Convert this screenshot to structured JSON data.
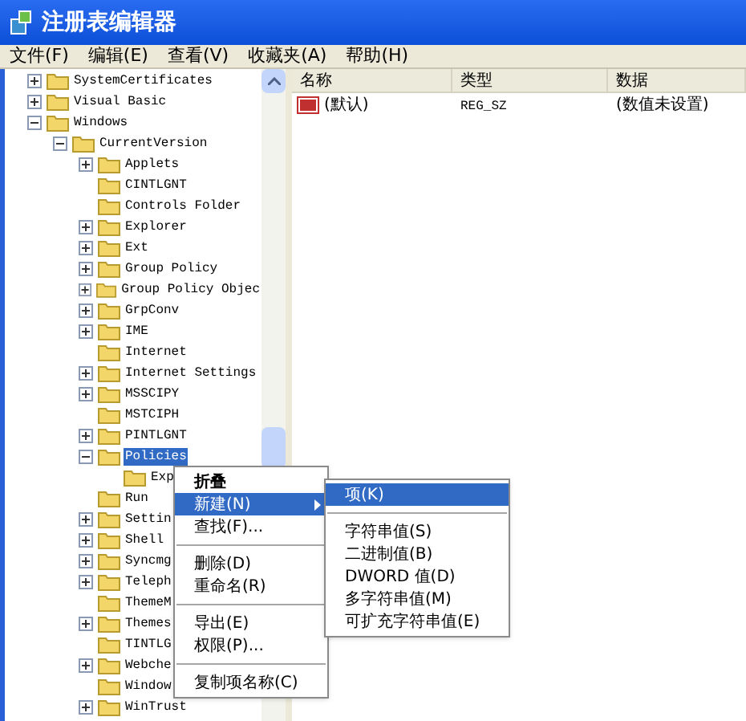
{
  "window": {
    "title": "注册表编辑器"
  },
  "menu_bar": [
    "文件(F)",
    "编辑(E)",
    "查看(V)",
    "收藏夹(A)",
    "帮助(H)"
  ],
  "tree": [
    {
      "label": "SystemCertificates",
      "kind": "node",
      "expanded": false,
      "selected": false
    },
    {
      "label": "Visual Basic",
      "kind": "node",
      "expanded": false,
      "selected": false
    },
    {
      "label": "Windows",
      "kind": "node",
      "expanded": true,
      "selected": false,
      "children": [
        {
          "label": "CurrentVersion",
          "kind": "node",
          "expanded": true,
          "selected": false,
          "children": [
            {
              "label": "Applets",
              "kind": "node",
              "expanded": false,
              "selected": false
            },
            {
              "label": "CINTLGNT",
              "kind": "leaf",
              "selected": false
            },
            {
              "label": "Controls Folder",
              "kind": "leaf",
              "selected": false
            },
            {
              "label": "Explorer",
              "kind": "node",
              "expanded": false,
              "selected": false
            },
            {
              "label": "Ext",
              "kind": "node",
              "expanded": false,
              "selected": false
            },
            {
              "label": "Group Policy",
              "kind": "node",
              "expanded": false,
              "selected": false
            },
            {
              "label": "Group Policy Objec",
              "kind": "node",
              "expanded": false,
              "selected": false
            },
            {
              "label": "GrpConv",
              "kind": "node",
              "expanded": false,
              "selected": false
            },
            {
              "label": "IME",
              "kind": "node",
              "expanded": false,
              "selected": false
            },
            {
              "label": "Internet",
              "kind": "leaf",
              "selected": false
            },
            {
              "label": "Internet Settings",
              "kind": "node",
              "expanded": false,
              "selected": false
            },
            {
              "label": "MSSCIPY",
              "kind": "node",
              "expanded": false,
              "selected": false
            },
            {
              "label": "MSTCIPH",
              "kind": "leaf",
              "selected": false
            },
            {
              "label": "PINTLGNT",
              "kind": "node",
              "expanded": false,
              "selected": false
            },
            {
              "label": "Policies",
              "kind": "node",
              "expanded": true,
              "selected": true,
              "children": [
                {
                  "label": "Exp",
                  "kind": "leaf",
                  "selected": false
                }
              ]
            },
            {
              "label": "Run",
              "kind": "leaf",
              "selected": false
            },
            {
              "label": "Settin",
              "kind": "node",
              "expanded": false,
              "selected": false
            },
            {
              "label": "Shell",
              "kind": "node",
              "expanded": false,
              "selected": false
            },
            {
              "label": "Syncmg",
              "kind": "node",
              "expanded": false,
              "selected": false
            },
            {
              "label": "Teleph",
              "kind": "node",
              "expanded": false,
              "selected": false
            },
            {
              "label": "ThemeM",
              "kind": "leaf",
              "selected": false
            },
            {
              "label": "Themes",
              "kind": "node",
              "expanded": false,
              "selected": false
            },
            {
              "label": "TINTLG",
              "kind": "leaf",
              "selected": false
            },
            {
              "label": "Webche",
              "kind": "node",
              "expanded": false,
              "selected": false
            },
            {
              "label": "Window",
              "kind": "leaf",
              "selected": false
            },
            {
              "label": "WinTrust",
              "kind": "node",
              "expanded": false,
              "selected": false
            }
          ]
        }
      ]
    }
  ],
  "values_table": {
    "columns": [
      "名称",
      "类型",
      "数据"
    ],
    "rows": [
      {
        "name": "(默认)",
        "type": "REG_SZ",
        "data": "(数值未设置)"
      }
    ]
  },
  "context_menu": [
    {
      "kind": "item",
      "label": "折叠",
      "bold": true,
      "selected": false,
      "submenu": false
    },
    {
      "kind": "item",
      "label": "新建(N)",
      "bold": false,
      "selected": true,
      "submenu": true
    },
    {
      "kind": "item",
      "label": "查找(F)...",
      "bold": false,
      "selected": false,
      "submenu": false
    },
    {
      "kind": "separator"
    },
    {
      "kind": "item",
      "label": "删除(D)",
      "bold": false,
      "selected": false,
      "submenu": false
    },
    {
      "kind": "item",
      "label": "重命名(R)",
      "bold": false,
      "selected": false,
      "submenu": false
    },
    {
      "kind": "separator"
    },
    {
      "kind": "item",
      "label": "导出(E)",
      "bold": false,
      "selected": false,
      "submenu": false
    },
    {
      "kind": "item",
      "label": "权限(P)...",
      "bold": false,
      "selected": false,
      "submenu": false
    },
    {
      "kind": "separator"
    },
    {
      "kind": "item",
      "label": "复制项名称(C)",
      "bold": false,
      "selected": false,
      "submenu": false
    }
  ],
  "submenu": [
    {
      "kind": "item",
      "label": "项(K)",
      "selected": true
    },
    {
      "kind": "separator"
    },
    {
      "kind": "item",
      "label": "字符串值(S)",
      "selected": false
    },
    {
      "kind": "item",
      "label": "二进制值(B)",
      "selected": false
    },
    {
      "kind": "item",
      "label": "DWORD 值(D)",
      "selected": false
    },
    {
      "kind": "item",
      "label": "多字符串值(M)",
      "selected": false
    },
    {
      "kind": "item",
      "label": "可扩充字符串值(E)",
      "selected": false
    }
  ]
}
